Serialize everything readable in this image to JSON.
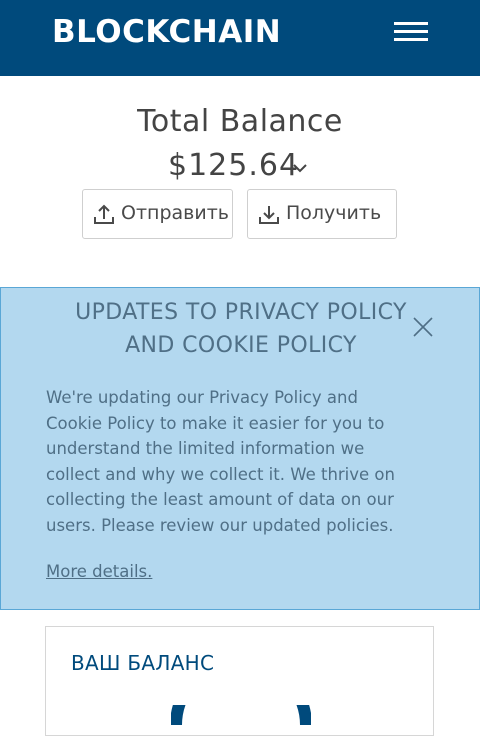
{
  "header": {
    "logo": "BLOCKCHAIN",
    "menu_icon": "hamburger-menu-icon"
  },
  "balance": {
    "label": "Total Balance",
    "amount": "$125.64",
    "caret_icon": "chevron-down-icon"
  },
  "actions": {
    "send": {
      "label": "Отправить",
      "icon": "upload-icon"
    },
    "receive": {
      "label": "Получить",
      "icon": "download-icon"
    }
  },
  "notice": {
    "title_line1": "UPDATES TO PRIVACY POLICY",
    "title_line2": "AND COOKIE POLICY",
    "body_lines": [
      "We're updating our Privacy Policy and",
      "Cookie Policy to make it easier for you to",
      "understand the limited information we",
      "collect and why we collect it. We thrive on",
      "collecting the least amount of data on our",
      "users. Please review our updated policies."
    ],
    "link": "More details.",
    "close_icon": "close-icon"
  },
  "card": {
    "title": "ВАШ БАЛАНС"
  },
  "colors": {
    "brand": "#004a7c",
    "notice_bg": "#b3d8ef",
    "notice_border": "#5aa7d6"
  }
}
